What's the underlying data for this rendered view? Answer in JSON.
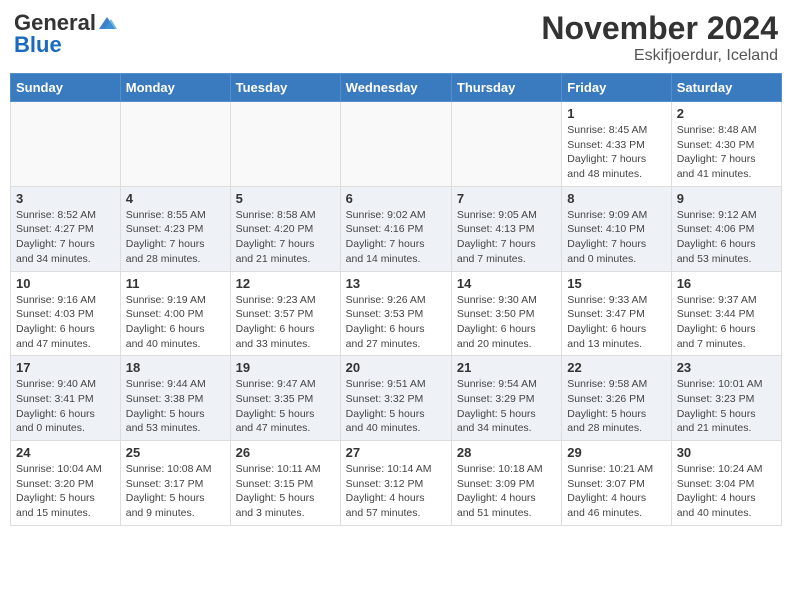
{
  "header": {
    "logo_general": "General",
    "logo_blue": "Blue",
    "month_year": "November 2024",
    "location": "Eskifjoerdur, Iceland"
  },
  "weekdays": [
    "Sunday",
    "Monday",
    "Tuesday",
    "Wednesday",
    "Thursday",
    "Friday",
    "Saturday"
  ],
  "weeks": [
    [
      {
        "day": "",
        "info": ""
      },
      {
        "day": "",
        "info": ""
      },
      {
        "day": "",
        "info": ""
      },
      {
        "day": "",
        "info": ""
      },
      {
        "day": "",
        "info": ""
      },
      {
        "day": "1",
        "info": "Sunrise: 8:45 AM\nSunset: 4:33 PM\nDaylight: 7 hours\nand 48 minutes."
      },
      {
        "day": "2",
        "info": "Sunrise: 8:48 AM\nSunset: 4:30 PM\nDaylight: 7 hours\nand 41 minutes."
      }
    ],
    [
      {
        "day": "3",
        "info": "Sunrise: 8:52 AM\nSunset: 4:27 PM\nDaylight: 7 hours\nand 34 minutes."
      },
      {
        "day": "4",
        "info": "Sunrise: 8:55 AM\nSunset: 4:23 PM\nDaylight: 7 hours\nand 28 minutes."
      },
      {
        "day": "5",
        "info": "Sunrise: 8:58 AM\nSunset: 4:20 PM\nDaylight: 7 hours\nand 21 minutes."
      },
      {
        "day": "6",
        "info": "Sunrise: 9:02 AM\nSunset: 4:16 PM\nDaylight: 7 hours\nand 14 minutes."
      },
      {
        "day": "7",
        "info": "Sunrise: 9:05 AM\nSunset: 4:13 PM\nDaylight: 7 hours\nand 7 minutes."
      },
      {
        "day": "8",
        "info": "Sunrise: 9:09 AM\nSunset: 4:10 PM\nDaylight: 7 hours\nand 0 minutes."
      },
      {
        "day": "9",
        "info": "Sunrise: 9:12 AM\nSunset: 4:06 PM\nDaylight: 6 hours\nand 53 minutes."
      }
    ],
    [
      {
        "day": "10",
        "info": "Sunrise: 9:16 AM\nSunset: 4:03 PM\nDaylight: 6 hours\nand 47 minutes."
      },
      {
        "day": "11",
        "info": "Sunrise: 9:19 AM\nSunset: 4:00 PM\nDaylight: 6 hours\nand 40 minutes."
      },
      {
        "day": "12",
        "info": "Sunrise: 9:23 AM\nSunset: 3:57 PM\nDaylight: 6 hours\nand 33 minutes."
      },
      {
        "day": "13",
        "info": "Sunrise: 9:26 AM\nSunset: 3:53 PM\nDaylight: 6 hours\nand 27 minutes."
      },
      {
        "day": "14",
        "info": "Sunrise: 9:30 AM\nSunset: 3:50 PM\nDaylight: 6 hours\nand 20 minutes."
      },
      {
        "day": "15",
        "info": "Sunrise: 9:33 AM\nSunset: 3:47 PM\nDaylight: 6 hours\nand 13 minutes."
      },
      {
        "day": "16",
        "info": "Sunrise: 9:37 AM\nSunset: 3:44 PM\nDaylight: 6 hours\nand 7 minutes."
      }
    ],
    [
      {
        "day": "17",
        "info": "Sunrise: 9:40 AM\nSunset: 3:41 PM\nDaylight: 6 hours\nand 0 minutes."
      },
      {
        "day": "18",
        "info": "Sunrise: 9:44 AM\nSunset: 3:38 PM\nDaylight: 5 hours\nand 53 minutes."
      },
      {
        "day": "19",
        "info": "Sunrise: 9:47 AM\nSunset: 3:35 PM\nDaylight: 5 hours\nand 47 minutes."
      },
      {
        "day": "20",
        "info": "Sunrise: 9:51 AM\nSunset: 3:32 PM\nDaylight: 5 hours\nand 40 minutes."
      },
      {
        "day": "21",
        "info": "Sunrise: 9:54 AM\nSunset: 3:29 PM\nDaylight: 5 hours\nand 34 minutes."
      },
      {
        "day": "22",
        "info": "Sunrise: 9:58 AM\nSunset: 3:26 PM\nDaylight: 5 hours\nand 28 minutes."
      },
      {
        "day": "23",
        "info": "Sunrise: 10:01 AM\nSunset: 3:23 PM\nDaylight: 5 hours\nand 21 minutes."
      }
    ],
    [
      {
        "day": "24",
        "info": "Sunrise: 10:04 AM\nSunset: 3:20 PM\nDaylight: 5 hours\nand 15 minutes."
      },
      {
        "day": "25",
        "info": "Sunrise: 10:08 AM\nSunset: 3:17 PM\nDaylight: 5 hours\nand 9 minutes."
      },
      {
        "day": "26",
        "info": "Sunrise: 10:11 AM\nSunset: 3:15 PM\nDaylight: 5 hours\nand 3 minutes."
      },
      {
        "day": "27",
        "info": "Sunrise: 10:14 AM\nSunset: 3:12 PM\nDaylight: 4 hours\nand 57 minutes."
      },
      {
        "day": "28",
        "info": "Sunrise: 10:18 AM\nSunset: 3:09 PM\nDaylight: 4 hours\nand 51 minutes."
      },
      {
        "day": "29",
        "info": "Sunrise: 10:21 AM\nSunset: 3:07 PM\nDaylight: 4 hours\nand 46 minutes."
      },
      {
        "day": "30",
        "info": "Sunrise: 10:24 AM\nSunset: 3:04 PM\nDaylight: 4 hours\nand 40 minutes."
      }
    ]
  ]
}
